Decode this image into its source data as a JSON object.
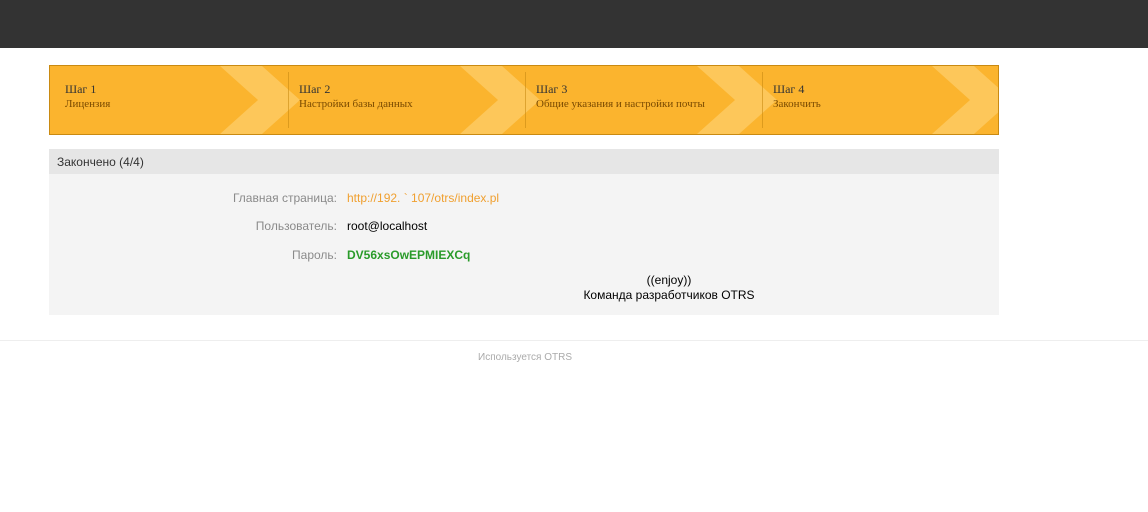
{
  "steps": [
    {
      "title": "Шаг 1",
      "subtitle": "Лицензия"
    },
    {
      "title": "Шаг 2",
      "subtitle": "Настройки базы данных"
    },
    {
      "title": "Шаг 3",
      "subtitle": "Общие указания и настройки почты"
    },
    {
      "title": "Шаг 4",
      "subtitle": "Закончить"
    }
  ],
  "panel": {
    "title": "Закончено (4/4)",
    "homepage_label": "Главная страница:",
    "homepage_value": "http://192.        `     107/otrs/index.pl",
    "user_label": "Пользователь:",
    "user_value": "root@localhost",
    "password_label": "Пароль:",
    "password_value": "DV56xsOwEPMIEXCq",
    "enjoy": "((enjoy))",
    "team": "Команда разработчиков OTRS"
  },
  "footer": {
    "powered_by": "Используется OTRS"
  },
  "colors": {
    "topbar": "#333333",
    "steps_bg": "#fbb42e",
    "link": "#f0a030",
    "password": "#2a9b2a"
  }
}
